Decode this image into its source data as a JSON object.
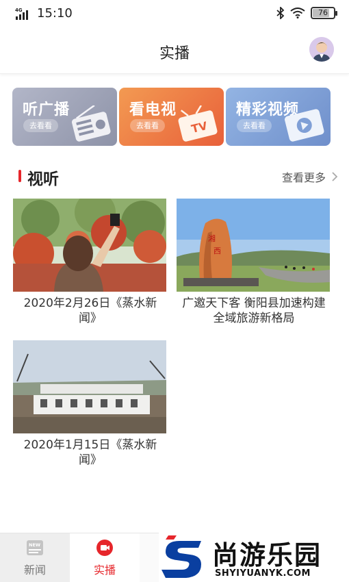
{
  "status_bar": {
    "network": "4G",
    "time": "15:10",
    "battery": "76"
  },
  "header": {
    "title": "实播"
  },
  "categories": [
    {
      "label": "听广播",
      "action": "去看看",
      "icon": "radio-icon"
    },
    {
      "label": "看电视",
      "action": "去看看",
      "icon": "tv-icon"
    },
    {
      "label": "精彩视频",
      "action": "去看看",
      "icon": "play-video-icon"
    }
  ],
  "section": {
    "title": "视听",
    "more": "查看更多"
  },
  "videos": [
    {
      "title": "2020年2月26日《蒸水新闻》"
    },
    {
      "title": "广邀天下客 衡阳县加速构建全域旅游新格局"
    },
    {
      "title": "2020年1月15日《蒸水新闻》"
    }
  ],
  "tabs": [
    {
      "label": "新闻",
      "icon": "news-icon"
    },
    {
      "label": "实播",
      "icon": "live-camera-icon"
    }
  ],
  "watermark": {
    "text": "尚游乐园",
    "url": "SHYIYUANYK.COM"
  },
  "colors": {
    "accent": "#e6262b",
    "tv_card": "#ec6e44",
    "radio_card": "#9da1b6",
    "video_card": "#7f9fd6"
  }
}
